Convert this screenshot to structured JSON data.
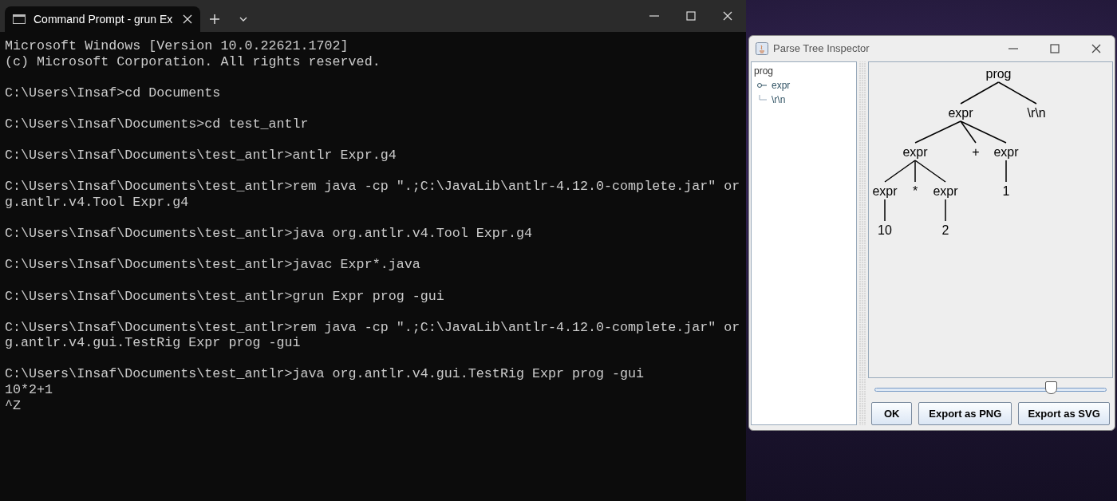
{
  "terminal": {
    "tab_title": "Command Prompt - grun  Ex",
    "blocks": [
      [
        "Microsoft Windows [Version 10.0.22621.1702]",
        "(c) Microsoft Corporation. All rights reserved."
      ],
      [
        "C:\\Users\\Insaf>cd Documents"
      ],
      [
        "C:\\Users\\Insaf\\Documents>cd test_antlr"
      ],
      [
        "C:\\Users\\Insaf\\Documents\\test_antlr>antlr Expr.g4"
      ],
      [
        "C:\\Users\\Insaf\\Documents\\test_antlr>rem java -cp \".;C:\\JavaLib\\antlr-4.12.0-complete.jar\" or",
        "g.antlr.v4.Tool Expr.g4"
      ],
      [
        "C:\\Users\\Insaf\\Documents\\test_antlr>java org.antlr.v4.Tool Expr.g4"
      ],
      [
        "C:\\Users\\Insaf\\Documents\\test_antlr>javac Expr*.java"
      ],
      [
        "C:\\Users\\Insaf\\Documents\\test_antlr>grun Expr prog -gui"
      ],
      [
        "C:\\Users\\Insaf\\Documents\\test_antlr>rem java -cp \".;C:\\JavaLib\\antlr-4.12.0-complete.jar\" or",
        "g.antlr.v4.gui.TestRig Expr prog -gui"
      ],
      [
        "C:\\Users\\Insaf\\Documents\\test_antlr>java org.antlr.v4.gui.TestRig Expr prog -gui",
        "10*2+1",
        "^Z"
      ]
    ]
  },
  "inspector": {
    "title": "Parse Tree Inspector",
    "tree_view": {
      "label": "prog",
      "expanded": true,
      "children": [
        {
          "label": "expr",
          "expanded": false
        },
        {
          "label": "\\r\\n"
        }
      ]
    },
    "parse_tree": {
      "label": "prog",
      "children": [
        {
          "label": "expr",
          "children": [
            {
              "label": "expr",
              "children": [
                {
                  "label": "expr",
                  "children": [
                    {
                      "label": "10"
                    }
                  ]
                },
                {
                  "label": "*"
                },
                {
                  "label": "expr",
                  "children": [
                    {
                      "label": "2"
                    }
                  ]
                }
              ]
            },
            {
              "label": "+"
            },
            {
              "label": "expr",
              "children": [
                {
                  "label": "1"
                }
              ]
            }
          ]
        },
        {
          "label": "\\r\\n"
        }
      ]
    },
    "zoom_slider": {
      "level": 0.76
    },
    "buttons": [
      "OK",
      "Export as PNG",
      "Export as SVG"
    ]
  }
}
